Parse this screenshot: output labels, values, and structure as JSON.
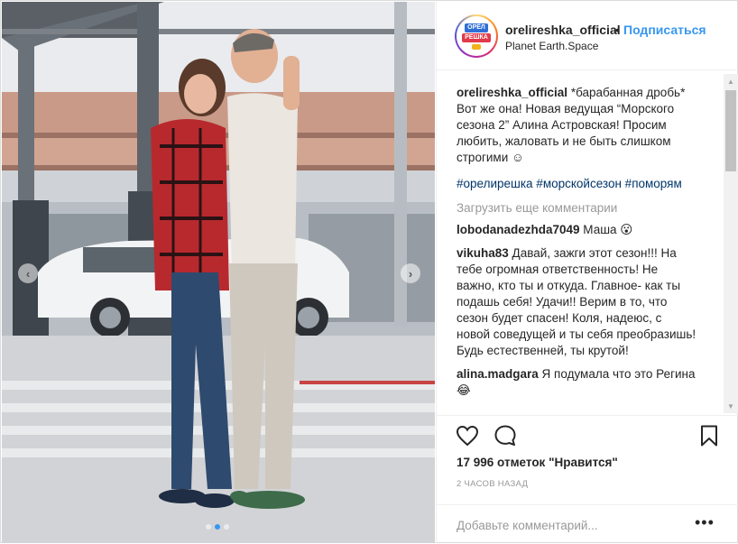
{
  "post": {
    "username": "orelireshka_official",
    "separator": "•",
    "follow_label": "Подписаться",
    "location": "Planet Earth.Space",
    "avatar_logo_top": "ОРЁЛ",
    "avatar_logo_bottom": "РЕШКА",
    "caption_user": "orelireshka_official",
    "caption_text": " *барабанная дробь* Вот же она! Новая ведущая “Морского сезона 2” Алина Астровская! Просим любить, жаловать и не быть слишком строгими ☺",
    "hashtags": "#орелирешка #морскойсезон #поморям",
    "load_more": "Загрузить еще комментарии",
    "comments": [
      {
        "user": "lobodanadezhda7049",
        "text": " Маша 😮"
      },
      {
        "user": "vikuha83",
        "text": " Давай, зажги этот сезон!!! На тебе огромная ответственность! Не важно, кто ты и откуда. Главное- как ты подашь себя! Удачи!! Верим в то, что сезон будет спасен! Коля, надеюс, с новой соведущей и ты себя преобразишь! Будь естественней, ты крутой!"
      },
      {
        "user": "alina.madgara",
        "text": " Я подумала что это Регина 😂"
      }
    ],
    "likes": "17 996 отметок \"Нравится\"",
    "time": "2 ЧАСОВ НАЗАД",
    "add_comment_placeholder": "Добавьте комментарий...",
    "more_label": "•••",
    "carousel": {
      "slides": 3,
      "active": 2
    },
    "colors": {
      "accent": "#3897f0",
      "hashtag": "#003569",
      "muted": "#999999"
    },
    "icons": [
      "heart-icon",
      "comment-icon",
      "bookmark-icon",
      "chevron-left-icon",
      "chevron-right-icon"
    ]
  }
}
